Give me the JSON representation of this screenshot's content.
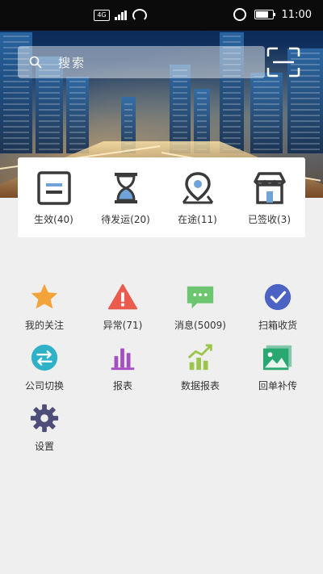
{
  "status_bar": {
    "time": "11:00",
    "sim_badge": "4G"
  },
  "search": {
    "placeholder": "搜索"
  },
  "shipments": [
    {
      "label": "生效(40)",
      "icon": "document-icon"
    },
    {
      "label": "待发运(20)",
      "icon": "hourglass-icon"
    },
    {
      "label": "在途(11)",
      "icon": "map-pin-icon"
    },
    {
      "label": "已签收(3)",
      "icon": "store-icon"
    }
  ],
  "menu": [
    {
      "label": "我的关注",
      "icon": "star-icon",
      "color": "#f2a33a"
    },
    {
      "label": "异常(71)",
      "icon": "warning-icon",
      "color": "#ea5a4d"
    },
    {
      "label": "消息(5009)",
      "icon": "message-icon",
      "color": "#6cc56f"
    },
    {
      "label": "扫箱收货",
      "icon": "check-circle-icon",
      "color": "#4c63c4"
    },
    {
      "label": "公司切换",
      "icon": "switch-icon",
      "color": "#2fb2c8"
    },
    {
      "label": "报表",
      "icon": "bar-chart-icon",
      "color": "#a54ec1"
    },
    {
      "label": "数据报表",
      "icon": "trend-chart-icon",
      "color": "#9bc64b"
    },
    {
      "label": "回单补传",
      "icon": "image-upload-icon",
      "color": "#2aa872"
    },
    {
      "label": "设置",
      "icon": "gear-icon",
      "color": "#4e4d7a"
    }
  ]
}
